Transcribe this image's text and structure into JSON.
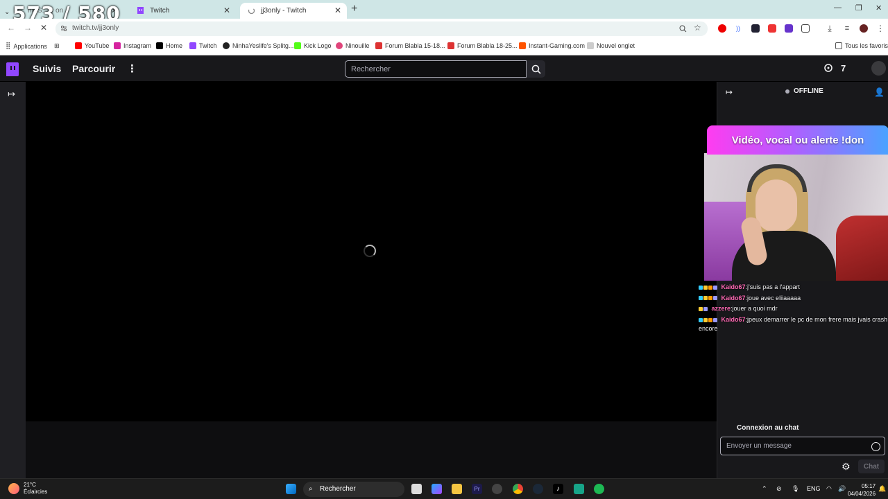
{
  "overlay_counter": "573 / 580",
  "browser": {
    "tabs": [
      {
        "label": "Twitch",
        "active": false
      },
      {
        "label": "jj3only - Twitch",
        "active": true
      }
    ],
    "address": "twitch.tv/jj3only",
    "bookmarks": [
      {
        "label": "Applications",
        "color": "#4a4a4a"
      },
      {
        "label": "YouTube",
        "color": "#ff0000"
      },
      {
        "label": "Instagram",
        "color": "#d6249f"
      },
      {
        "label": "Home",
        "color": "#000000"
      },
      {
        "label": "Twitch",
        "color": "#9147ff"
      },
      {
        "label": "NinhaYeslife's Splitg...",
        "color": "#222222"
      },
      {
        "label": "Kick Logo",
        "color": "#53fc18"
      },
      {
        "label": "Ninouille",
        "color": "#e0457b"
      },
      {
        "label": "Forum Blabla 15-18...",
        "color": "#d33"
      },
      {
        "label": "Forum Blabla 18-25...",
        "color": "#d33"
      },
      {
        "label": "Instant-Gaming.com",
        "color": "#ff5400"
      },
      {
        "label": "Nouvel onglet",
        "color": "#888888"
      }
    ],
    "all_bookmarks": "Tous les favoris"
  },
  "twitch": {
    "nav": {
      "following": "Suivis",
      "browse": "Parcourir",
      "search_placeholder": "Rechercher"
    },
    "chat": {
      "status": "OFFLINE",
      "banner": "Vidéo, vocal ou alerte !don",
      "messages": [
        {
          "user": "Kaido67",
          "user_color": "#ff69b4",
          "text": ":j'suis pas a l'appart"
        },
        {
          "user": "Kaido67",
          "user_color": "#ff69b4",
          "text": ":joue avec eliiaaaaa"
        },
        {
          "user": "azzere",
          "user_color": "#ff69b4",
          "text": ":jouer a quoi mdr"
        },
        {
          "user": "Kaido67",
          "user_color": "#ff69b4",
          "text": ":jpeux demarrer le pc de mon frere mais jvais crash encore"
        }
      ],
      "connect_label": "Connexion au chat",
      "input_placeholder": "Envoyer un message",
      "chat_button": "Chat"
    }
  },
  "taskbar": {
    "weather_temp": "21°C",
    "weather_desc": "Éclaircies",
    "search_label": "Rechercher",
    "lang": "ENG",
    "time": "05:17",
    "date": "04/04/2026"
  },
  "colors": {
    "twitch_purple": "#9147ff",
    "twitch_bg": "#0e0e10",
    "nav_bg": "#18181b"
  }
}
